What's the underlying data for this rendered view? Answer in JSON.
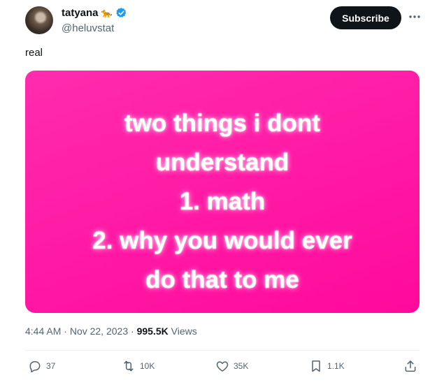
{
  "author": {
    "display_name": "tatyana",
    "emoji": "🐆",
    "handle": "@heluvstat"
  },
  "header": {
    "subscribe_label": "Subscribe"
  },
  "tweet": {
    "text": "real",
    "image_lines": [
      "two things i dont",
      "understand",
      "1. math",
      "2. why you would ever",
      "do that to me"
    ]
  },
  "meta": {
    "time": "4:44 AM",
    "date": "Nov 22, 2023",
    "views_count": "995.5K",
    "views_label": "Views"
  },
  "actions": {
    "replies": "37",
    "reposts": "10K",
    "likes": "35K",
    "bookmarks": "1.1K"
  },
  "colors": {
    "image_bg": "#ff1aa5",
    "verified": "#1d9bf0",
    "text_secondary": "#536471"
  }
}
